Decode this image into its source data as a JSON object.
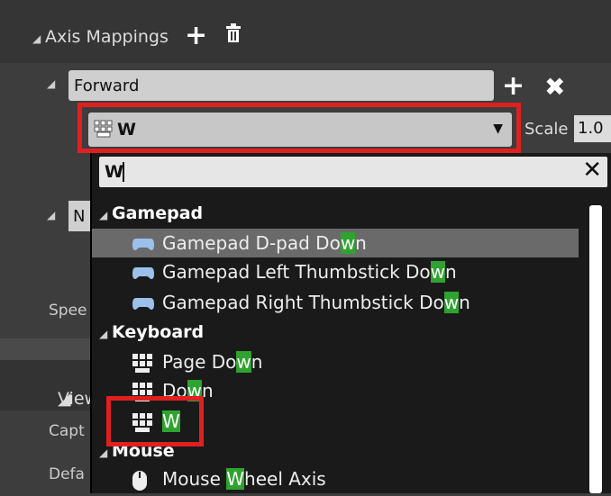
{
  "header": {
    "title": "Axis Mappings"
  },
  "mapping": {
    "name_value": "Forward",
    "key_value": "W",
    "scale_label": "Scale",
    "scale_value": "1.0"
  },
  "second_mapping": {
    "name_partial": "N"
  },
  "side_labels": {
    "speed": "Spee",
    "view": "View",
    "capt": "Capt",
    "defa": "Defa"
  },
  "dropdown": {
    "search_value": "W",
    "categories": {
      "gamepad": "Gamepad",
      "keyboard": "Keyboard",
      "mouse": "Mouse"
    },
    "items": [
      {
        "pre": "Gamepad D-pad Do",
        "hl": "w",
        "post": "n",
        "icon": "gamepad-icon",
        "selected": true
      },
      {
        "pre": "Gamepad Left Thumbstick Do",
        "hl": "w",
        "post": "n",
        "icon": "gamepad-icon"
      },
      {
        "pre": "Gamepad Right Thumbstick Do",
        "hl": "w",
        "post": "n",
        "icon": "gamepad-icon"
      },
      {
        "pre": "Page Do",
        "hl": "w",
        "post": "n",
        "icon": "keyboard-icon"
      },
      {
        "pre": "Do",
        "hl": "w",
        "post": "n",
        "icon": "keyboard-icon"
      },
      {
        "pre": "",
        "hl": "W",
        "post": "",
        "icon": "keyboard-icon"
      },
      {
        "pre": "Mouse ",
        "hl": "W",
        "post": "heel Axis",
        "icon": "mouse-icon"
      }
    ]
  },
  "colors": {
    "highlight_box": "#e02020",
    "match_highlight": "#2fa32f"
  }
}
